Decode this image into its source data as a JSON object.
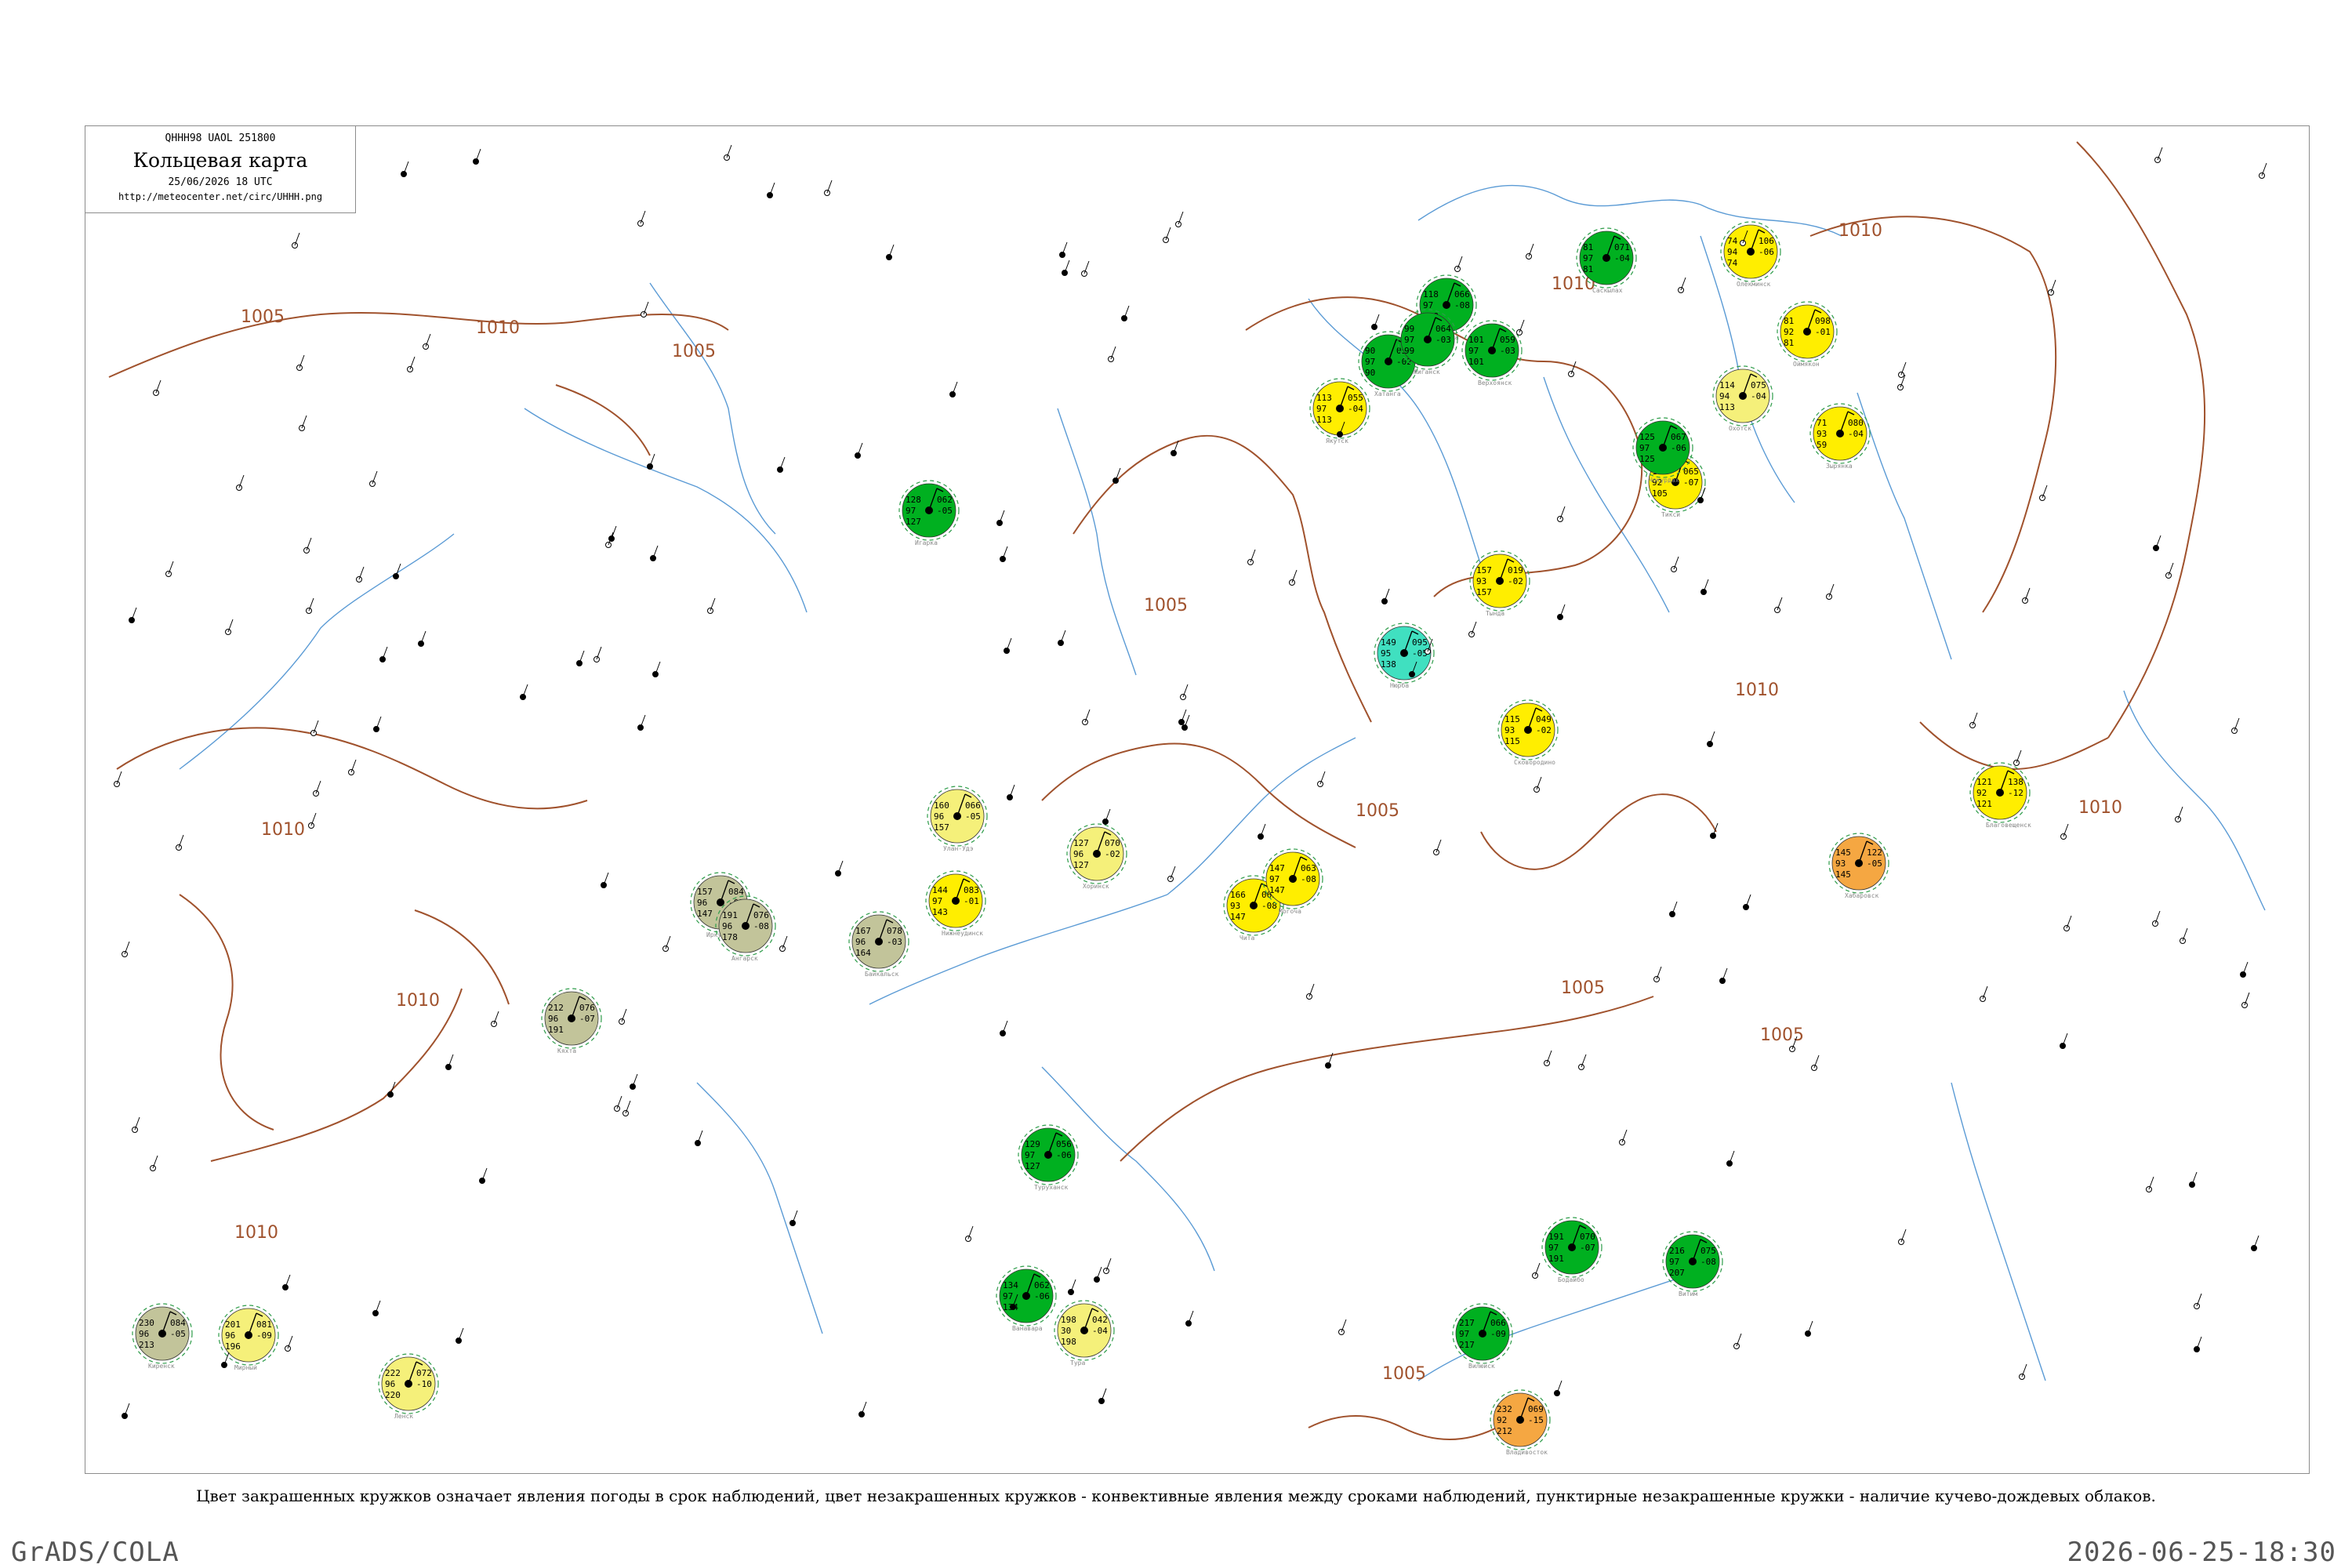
{
  "header": {
    "code_line": "QHHH98  UAOL  251800",
    "title": "Кольцевая карта",
    "datetime": "25/06/2026 18 UTC",
    "url": "http://meteocenter.net/circ/UHHH.png"
  },
  "caption": "Цвет закрашенных кружков означает явления погоды в срок наблюдений, цвет незакрашенных кружков - конвективные явления между сроками наблюдений, пунктирные незакрашенные кружки - наличие кучево-дождевых облаков.",
  "footer": {
    "left": "GrADS/COLA",
    "right": "2026-06-25-18:30"
  },
  "colors": {
    "isobar": "#a0522d",
    "river": "#5b9bd5",
    "rain": "#00b020",
    "showers_light": "#f5f07a",
    "showers": "#ffee00",
    "fog": "#c2c49a",
    "thunder": "#f5a742",
    "drizzle": "#40e0c0",
    "cb_dashed": "#2e9d4a",
    "convective": "#e0507a"
  },
  "isobars": [
    {
      "label": "1005",
      "value": 1005
    },
    {
      "label": "1005",
      "value": 1005
    },
    {
      "label": "1005",
      "value": 1005
    },
    {
      "label": "1005",
      "value": 1005
    },
    {
      "label": "1005",
      "value": 1005
    },
    {
      "label": "1005",
      "value": 1005
    },
    {
      "label": "1005",
      "value": 1005
    },
    {
      "label": "1010",
      "value": 1010
    },
    {
      "label": "1010",
      "value": 1010
    },
    {
      "label": "1010",
      "value": 1010
    },
    {
      "label": "1010",
      "value": 1010
    },
    {
      "label": "1010",
      "value": 1010
    },
    {
      "label": "1010",
      "value": 1010
    },
    {
      "label": "1010",
      "value": 1010
    },
    {
      "label": "1010",
      "value": 1010
    }
  ],
  "stations": [
    {
      "name": "Нижнеудинск",
      "p": "144",
      "t": "97",
      "d": "143",
      "tend": "083",
      "tdiff": "-01",
      "wx": "showers"
    },
    {
      "name": "Иркутск",
      "p": "157",
      "t": "96",
      "d": "147",
      "tend": "084",
      "tdiff": "-02",
      "wx": "fog"
    },
    {
      "name": "Ангарск",
      "p": "191",
      "t": "96",
      "d": "178",
      "tend": "076",
      "tdiff": "-08",
      "wx": "fog"
    },
    {
      "name": "Байкальск",
      "p": "167",
      "t": "96",
      "d": "164",
      "tend": "078",
      "tdiff": "-03",
      "wx": "fog"
    },
    {
      "name": "Кяхта",
      "p": "212",
      "t": "96",
      "d": "191",
      "tend": "076",
      "tdiff": "-07",
      "wx": "fog"
    },
    {
      "name": "Улан-Удэ",
      "p": "160",
      "t": "96",
      "d": "157",
      "tend": "066",
      "tdiff": "-05",
      "wx": "showers_light"
    },
    {
      "name": "Хоринск",
      "p": "127",
      "t": "96",
      "d": "127",
      "tend": "070",
      "tdiff": "-02",
      "wx": "showers_light"
    },
    {
      "name": "Чита",
      "p": "166",
      "t": "93",
      "d": "147",
      "tend": "065",
      "tdiff": "-08",
      "wx": "showers"
    },
    {
      "name": "Могоча",
      "p": "147",
      "t": "97",
      "d": "147",
      "tend": "063",
      "tdiff": "-08",
      "wx": "showers"
    },
    {
      "name": "Сковородино",
      "p": "115",
      "t": "93",
      "d": "115",
      "tend": "049",
      "tdiff": "-02",
      "wx": "showers"
    },
    {
      "name": "Тында",
      "p": "157",
      "t": "93",
      "d": "157",
      "tend": "019",
      "tdiff": "-02",
      "wx": "showers"
    },
    {
      "name": "Благовещенск",
      "p": "121",
      "t": "92",
      "d": "121",
      "tend": "138",
      "tdiff": "-12",
      "wx": "showers"
    },
    {
      "name": "Хабаровск",
      "p": "145",
      "t": "93",
      "d": "145",
      "tend": "122",
      "tdiff": "-05",
      "wx": "thunder"
    },
    {
      "name": "Владивосток",
      "p": "232",
      "t": "92",
      "d": "212",
      "tend": "069",
      "tdiff": "-15",
      "wx": "thunder"
    },
    {
      "name": "Якутск",
      "p": "113",
      "t": "97",
      "d": "113",
      "tend": "055",
      "tdiff": "-04",
      "wx": "showers"
    },
    {
      "name": "Олёкминск",
      "p": "74",
      "t": "94",
      "d": "74",
      "tend": "106",
      "tdiff": "-06",
      "wx": "showers"
    },
    {
      "name": "Оймякон",
      "p": "81",
      "t": "92",
      "d": "81",
      "tend": "098",
      "tdiff": "-01",
      "wx": "showers"
    },
    {
      "name": "Зырянка",
      "p": "71",
      "t": "93",
      "d": "59",
      "tend": "080",
      "tdiff": "-04",
      "wx": "showers"
    },
    {
      "name": "Охотск",
      "p": "114",
      "t": "94",
      "d": "113",
      "tend": "075",
      "tdiff": "-04",
      "wx": "showers_light"
    },
    {
      "name": "Нюрба",
      "p": "149",
      "t": "95",
      "d": "138",
      "tend": "095",
      "tdiff": "-05",
      "wx": "drizzle"
    },
    {
      "name": "Мирный",
      "p": "201",
      "t": "96",
      "d": "196",
      "tend": "081",
      "tdiff": "-09",
      "wx": "showers_light"
    },
    {
      "name": "Ленск",
      "p": "222",
      "t": "96",
      "d": "220",
      "tend": "072",
      "tdiff": "-10",
      "wx": "showers_light"
    },
    {
      "name": "Киренск",
      "p": "230",
      "t": "96",
      "d": "213",
      "tend": "084",
      "tdiff": "-05",
      "wx": "fog"
    },
    {
      "name": "Тура",
      "p": "198",
      "t": "30",
      "d": "198",
      "tend": "042",
      "tdiff": "-04",
      "wx": "showers_light"
    },
    {
      "name": "Ванавара",
      "p": "134",
      "t": "97",
      "d": "134",
      "tend": "062",
      "tdiff": "-06",
      "wx": "rain"
    },
    {
      "name": "Туруханск",
      "p": "129",
      "t": "97",
      "d": "127",
      "tend": "056",
      "tdiff": "-06",
      "wx": "rain"
    },
    {
      "name": "Игарка",
      "p": "128",
      "t": "97",
      "d": "127",
      "tend": "062",
      "tdiff": "-05",
      "wx": "rain"
    },
    {
      "name": "Дудинка",
      "p": "118",
      "t": "97",
      "d": "118",
      "tend": "066",
      "tdiff": "-08",
      "wx": "rain"
    },
    {
      "name": "Хатанга",
      "p": "90",
      "t": "97",
      "d": "90",
      "tend": "058",
      "tdiff": "-02",
      "wx": "rain"
    },
    {
      "name": "Жиганск",
      "p": "99",
      "t": "97",
      "d": "99",
      "tend": "064",
      "tdiff": "-03",
      "wx": "rain"
    },
    {
      "name": "Верхоянск",
      "p": "101",
      "t": "97",
      "d": "101",
      "tend": "059",
      "tdiff": "-03",
      "wx": "rain"
    },
    {
      "name": "Саскылах",
      "p": "81",
      "t": "97",
      "d": "81",
      "tend": "071",
      "tdiff": "-04",
      "wx": "rain"
    },
    {
      "name": "Тикси",
      "p": "106",
      "t": "92",
      "d": "105",
      "tend": "065",
      "tdiff": "-07",
      "wx": "showers"
    },
    {
      "name": "Чокурдах",
      "p": "125",
      "t": "97",
      "d": "125",
      "tend": "067",
      "tdiff": "-06",
      "wx": "rain"
    },
    {
      "name": "Вилюйск",
      "p": "217",
      "t": "97",
      "d": "217",
      "tend": "066",
      "tdiff": "-09",
      "wx": "rain"
    },
    {
      "name": "Бодайбо",
      "p": "191",
      "t": "97",
      "d": "191",
      "tend": "070",
      "tdiff": "-07",
      "wx": "rain"
    },
    {
      "name": "Витим",
      "p": "216",
      "t": "97",
      "d": "207",
      "tend": "075",
      "tdiff": "-08",
      "wx": "rain"
    }
  ]
}
